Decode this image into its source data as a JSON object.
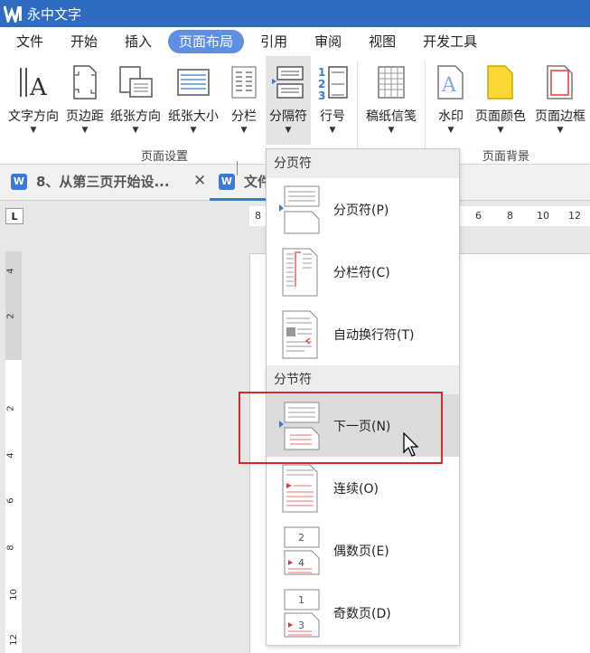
{
  "app": {
    "title": "永中文字"
  },
  "ribbon_tabs": [
    {
      "label": "文件"
    },
    {
      "label": "开始"
    },
    {
      "label": "插入"
    },
    {
      "label": "页面布局",
      "active": true
    },
    {
      "label": "引用"
    },
    {
      "label": "审阅"
    },
    {
      "label": "视图"
    },
    {
      "label": "开发工具"
    }
  ],
  "ribbon": {
    "buttons": [
      {
        "label": "文字方向",
        "icon": "text-direction-icon"
      },
      {
        "label": "页边距",
        "icon": "margins-icon"
      },
      {
        "label": "纸张方向",
        "icon": "orientation-icon"
      },
      {
        "label": "纸张大小",
        "icon": "paper-size-icon"
      },
      {
        "label": "分栏",
        "icon": "columns-icon"
      },
      {
        "label": "分隔符",
        "icon": "breaks-icon"
      },
      {
        "label": "行号",
        "icon": "line-numbers-icon"
      },
      {
        "label": "稿纸信笺",
        "icon": "manuscript-icon"
      },
      {
        "label": "水印",
        "icon": "watermark-icon"
      },
      {
        "label": "页面颜色",
        "icon": "page-color-icon"
      },
      {
        "label": "页面边框",
        "icon": "page-border-icon"
      }
    ],
    "groups": {
      "page_setup": "页面设置",
      "page_background": "页面背景"
    }
  },
  "doc_tabs": [
    {
      "label": "8、从第三页开始设..."
    },
    {
      "label": "文件"
    }
  ],
  "ruler": {
    "h_ticks": [
      "8",
      "6",
      "8",
      "10",
      "12"
    ],
    "v_ticks": [
      "4",
      "2",
      "2",
      "4",
      "6",
      "8",
      "10",
      "12"
    ]
  },
  "dropdown": {
    "page_break_header": "分页符",
    "section_break_header": "分节符",
    "items": [
      {
        "label": "分页符(P)",
        "icon": "page-break-icon"
      },
      {
        "label": "分栏符(C)",
        "icon": "column-break-icon"
      },
      {
        "label": "自动换行符(T)",
        "icon": "text-wrap-break-icon"
      },
      {
        "label": "下一页(N)",
        "icon": "next-page-break-icon"
      },
      {
        "label": "连续(O)",
        "icon": "continuous-break-icon"
      },
      {
        "label": "偶数页(E)",
        "icon": "even-page-break-icon"
      },
      {
        "label": "奇数页(D)",
        "icon": "odd-page-break-icon"
      }
    ]
  },
  "colors": {
    "titlebar": "#2d6cc0",
    "active_tab": "#5f8fe3",
    "highlight": "#e0262b"
  }
}
